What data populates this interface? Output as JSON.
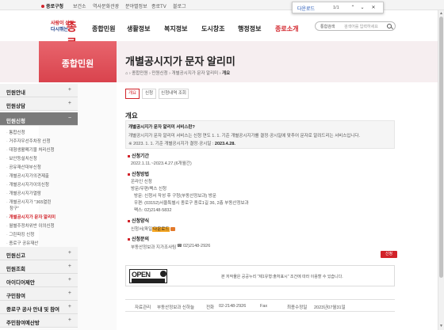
{
  "topbar": {
    "home": "종로구청",
    "links": [
      "보건소",
      "역사문화관광",
      "분야별정보",
      "종로TV",
      "블로그"
    ]
  },
  "find": {
    "query": "다운로드",
    "count": "1/1"
  },
  "logo": {
    "line1": "사람이 살맛",
    "line2": "다시뛰는",
    "main": "종로"
  },
  "gnb": [
    "종합민원",
    "생활정보",
    "복지정보",
    "도시창조",
    "행정정보",
    "종로소개"
  ],
  "search": {
    "select": "통합검색",
    "placeholder": "검색어를 입력하세요"
  },
  "sidebar_title": "종합민원",
  "page_title": "개별공시지가 문자 알리미",
  "breadcrumb": [
    "종합민원",
    "민원신청",
    "개별공시지가 문자 알리미",
    "개요"
  ],
  "menu": [
    {
      "label": "민원안내",
      "pm": "+"
    },
    {
      "label": "민원상담",
      "pm": "+"
    },
    {
      "label": "민원신청",
      "pm": "−"
    },
    {
      "label": "민원신고",
      "pm": "+"
    },
    {
      "label": "민원조회",
      "pm": "+"
    },
    {
      "label": "아이디어제안",
      "pm": "+"
    },
    {
      "label": "구민참여",
      "pm": "+"
    },
    {
      "label": "종로구 공사 안내 및 참여",
      "pm": "+"
    },
    {
      "label": "주민참여예산방",
      "pm": "+"
    }
  ],
  "submenu": [
    "통합신청",
    "거주자우선주차장 신청",
    "대형생활폐기물 처리신청",
    "보안등설치신청",
    "공유재산대부신청",
    "개별공시지가의견제출",
    "개별공시지가이의신청",
    "개별공시지가열람",
    "개별공시지가 \"365열린",
    "창구\"",
    "개별공시지가 문자 알리미",
    "월별주정차위반 이의신청",
    "그린파킹 신청",
    "종로구 공유재산"
  ],
  "tabs": [
    "개요",
    "신청",
    "신청내역 조회"
  ],
  "content": {
    "heading": "개요",
    "box_title": "개별공시지가 문자 알리미 서비스란?",
    "box_line1": "개별공시지가 문자 알리미 서비스는 신청 연도 1. 1. 기준 개별공시지가를 결정·공시일에 맞추어 문자로 알려드리는 서비스입니다.",
    "box_line2a": "※ 2023. 1. 1. 기준 개별공시지가 결정·공시일 : ",
    "box_line2b": "2023.4.28.",
    "sec1": "신청기간",
    "sec1_body": "2022.1.11.~2023.4.27.(6개월간)",
    "sec2": "신청방법",
    "sec2_items": [
      "온라인 신청",
      "방문/우편/팩스 신청",
      "방문: 신청서 작성 후 구청(부동산정보과) 방문",
      "우편: (03152)서울특별시 종로구 종로1길 36, 2층 부동산정보과",
      "팩스: 02)2148-5832"
    ],
    "sec3": "신청양식",
    "sec3_prefix": "신청서(파일",
    "sec3_hl": "다운로드",
    "sec4": "신청문의",
    "sec4_body": "부동산정보과 지가조사팀",
    "sec4_phone": "02)2148-2926",
    "apply": "신청"
  },
  "open": {
    "logo": "OPEN",
    "text": "본 저작물은 공공누리 \"제1유형:출처표시\" 조건에 따라 이용할 수 있습니다."
  },
  "footer": {
    "dept_label": "자료관리",
    "dept": "부동산정보과 신하늘",
    "tel_label": "전화",
    "tel": "02-2148-2926",
    "fax_label": "Fax",
    "updated_label": "최종수정일",
    "updated": "2023년07월31일"
  },
  "colors": {
    "brand": "#d2232a",
    "banner_bg": "#f6eef0",
    "highlight": "#f5a623"
  }
}
